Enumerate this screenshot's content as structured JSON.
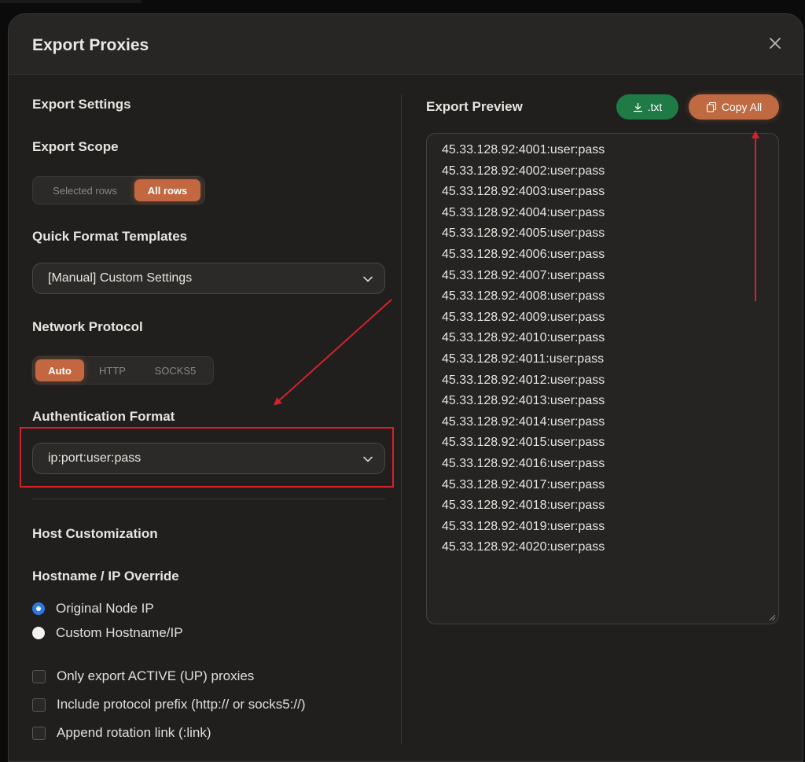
{
  "dialog": {
    "title": "Export Proxies"
  },
  "left": {
    "export_settings_heading": "Export Settings",
    "export_scope": {
      "heading": "Export Scope",
      "options": [
        "Selected rows",
        "All rows"
      ],
      "selected": "All rows"
    },
    "quick_format": {
      "heading": "Quick Format Templates",
      "value": "[Manual] Custom Settings"
    },
    "network_protocol": {
      "heading": "Network Protocol",
      "options": [
        "Auto",
        "HTTP",
        "SOCKS5"
      ],
      "selected": "Auto"
    },
    "auth_format": {
      "heading": "Authentication Format",
      "value": "ip:port:user:pass"
    },
    "host_customization_heading": "Host Customization",
    "hostname_override": {
      "heading": "Hostname / IP Override",
      "options": [
        "Original Node IP",
        "Custom Hostname/IP"
      ],
      "selected": "Original Node IP"
    },
    "checkboxes": [
      {
        "label": "Only export ACTIVE (UP) proxies",
        "checked": false
      },
      {
        "label": "Include protocol prefix (http:// or socks5://)",
        "checked": false
      },
      {
        "label": "Append rotation link (:link)",
        "checked": false
      }
    ]
  },
  "right": {
    "preview_heading": "Export Preview",
    "download_label": ".txt",
    "copy_label": "Copy All",
    "lines": [
      "45.33.128.92:4001:user:pass",
      "45.33.128.92:4002:user:pass",
      "45.33.128.92:4003:user:pass",
      "45.33.128.92:4004:user:pass",
      "45.33.128.92:4005:user:pass",
      "45.33.128.92:4006:user:pass",
      "45.33.128.92:4007:user:pass",
      "45.33.128.92:4008:user:pass",
      "45.33.128.92:4009:user:pass",
      "45.33.128.92:4010:user:pass",
      "45.33.128.92:4011:user:pass",
      "45.33.128.92:4012:user:pass",
      "45.33.128.92:4013:user:pass",
      "45.33.128.92:4014:user:pass",
      "45.33.128.92:4015:user:pass",
      "45.33.128.92:4016:user:pass",
      "45.33.128.92:4017:user:pass",
      "45.33.128.92:4018:user:pass",
      "45.33.128.92:4019:user:pass",
      "45.33.128.92:4020:user:pass"
    ]
  },
  "colors": {
    "accent": "#c2673f",
    "download_green": "#1f7a45",
    "annotation_red": "#d5222a",
    "radio_blue": "#2a7ae2"
  },
  "icons": {
    "close": "close-icon",
    "chevron": "chevron-down-icon",
    "download": "download-icon",
    "copy": "copy-icon"
  }
}
